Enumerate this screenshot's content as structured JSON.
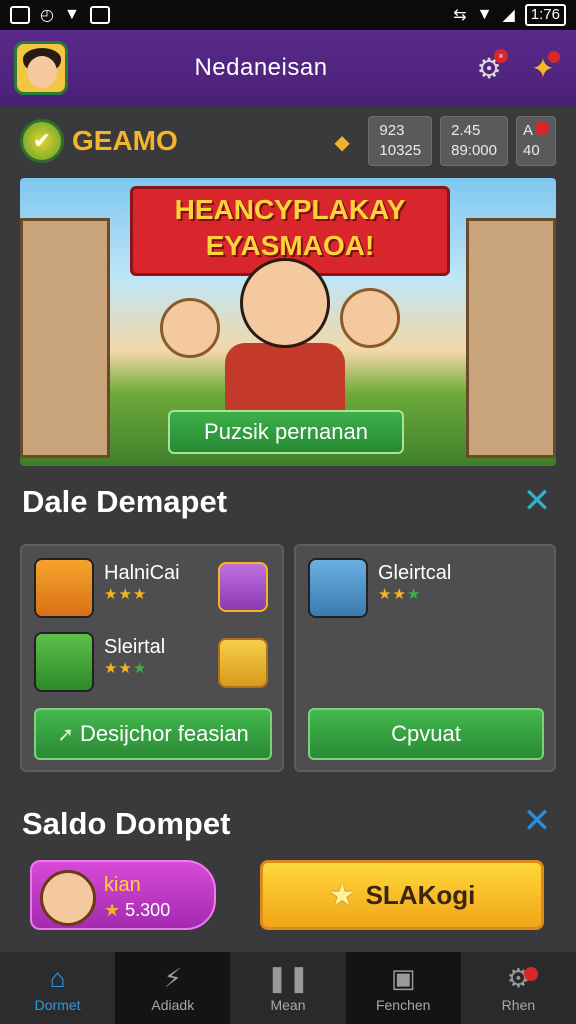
{
  "status_bar": {
    "time": "1:76"
  },
  "header": {
    "title": "Nedaneisan"
  },
  "brand": {
    "name": "GEAMO"
  },
  "stats": [
    {
      "line1": "923",
      "line2": "10325"
    },
    {
      "line1": "2.45",
      "line2": "89:000"
    },
    {
      "line1": "A",
      "line2": "40"
    }
  ],
  "hero": {
    "title_line1": "HEANCYPLAKAY",
    "title_line2": "EYASMAOA!",
    "button": "Puzsik pernanan"
  },
  "deals": {
    "title": "Dale Demapet",
    "left_items": [
      {
        "name": "HalniCai",
        "stars_y": "★★★",
        "stars_g": ""
      },
      {
        "name": "Sleirtal",
        "stars_y": "★★",
        "stars_g": "★"
      }
    ],
    "left_button": "Desijchor feasian",
    "right_item": {
      "name": "Gleirtcal",
      "stars_y": "★★",
      "stars_g": "★"
    },
    "right_button": "Cpvuat"
  },
  "saldo": {
    "title": "Saldo Dompet",
    "name": "kian",
    "value": "5.300",
    "button": "SLAKogi"
  },
  "nav": [
    {
      "label": "Dormet",
      "icon": "home-icon"
    },
    {
      "label": "Adiadk",
      "icon": "lightning-icon"
    },
    {
      "label": "Mean",
      "icon": "pause-icon"
    },
    {
      "label": "Fenchen",
      "icon": "clipboard-icon"
    },
    {
      "label": "Rhen",
      "icon": "gear-icon"
    }
  ]
}
